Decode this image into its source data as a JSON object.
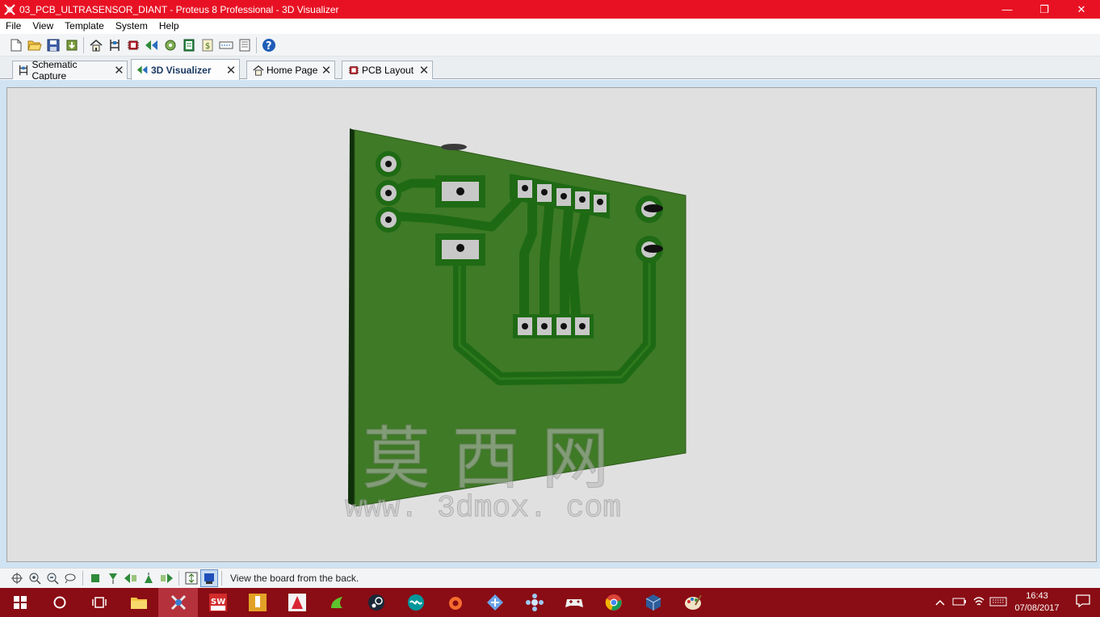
{
  "window": {
    "title": "03_PCB_ULTRASENSOR_DIANT - Proteus 8 Professional - 3D Visualizer",
    "minimize": "—",
    "maximize": "❐",
    "close": "✕"
  },
  "menu": [
    "File",
    "View",
    "Template",
    "System",
    "Help"
  ],
  "toolbar": {
    "icons": [
      "new-file-icon",
      "open-folder-icon",
      "save-icon",
      "import-icon",
      "home-page-icon",
      "schematic-capture-icon",
      "pcb-layout-icon",
      "3d-visualizer-icon",
      "gerber-viewer-icon",
      "bill-of-materials-icon",
      "design-explorer-icon",
      "netlist-icon",
      "notes-icon",
      "help-icon"
    ]
  },
  "tabs": [
    {
      "label": "Schematic Capture",
      "icon": "schematic-capture-icon",
      "active": false
    },
    {
      "label": "3D Visualizer",
      "icon": "3d-visualizer-icon",
      "active": true
    },
    {
      "label": "Home Page",
      "icon": "home-page-icon",
      "active": false
    },
    {
      "label": "PCB Layout",
      "icon": "pcb-layout-icon",
      "active": false
    }
  ],
  "tab_close": "✕",
  "watermark": {
    "chinese": "莫 西 网",
    "url": "www. 3dmox. com"
  },
  "status": {
    "text": "View the board from the back.",
    "icons": [
      "pan-icon",
      "zoom-in-icon",
      "zoom-out-icon",
      "zoom-extents-icon",
      "top-view-icon",
      "front-view-icon",
      "left-view-icon",
      "back-view-icon",
      "right-view-icon",
      "height-toggle-icon",
      "board-view-icon"
    ]
  },
  "taskbar": {
    "apps": [
      "windows-start-icon",
      "cortana-icon",
      "task-view-icon",
      "file-explorer-icon",
      "proteus-icon",
      "solidworks-icon",
      "inventor-icon",
      "autocad-icon",
      "app-icon",
      "steam-icon",
      "arduino-icon",
      "origin-icon",
      "app-icon-2",
      "app-icon-3",
      "gamepad-icon",
      "chrome-icon",
      "virtualbox-icon",
      "paint-icon"
    ],
    "clock_time": "16:43",
    "clock_date": "07/08/2017"
  },
  "colors": {
    "titlebar": "#e81123",
    "taskbar": "#8a0c14",
    "pcb": "#3f7a26",
    "trace": "#1f6a16",
    "viewport": "#e0e0e0"
  }
}
